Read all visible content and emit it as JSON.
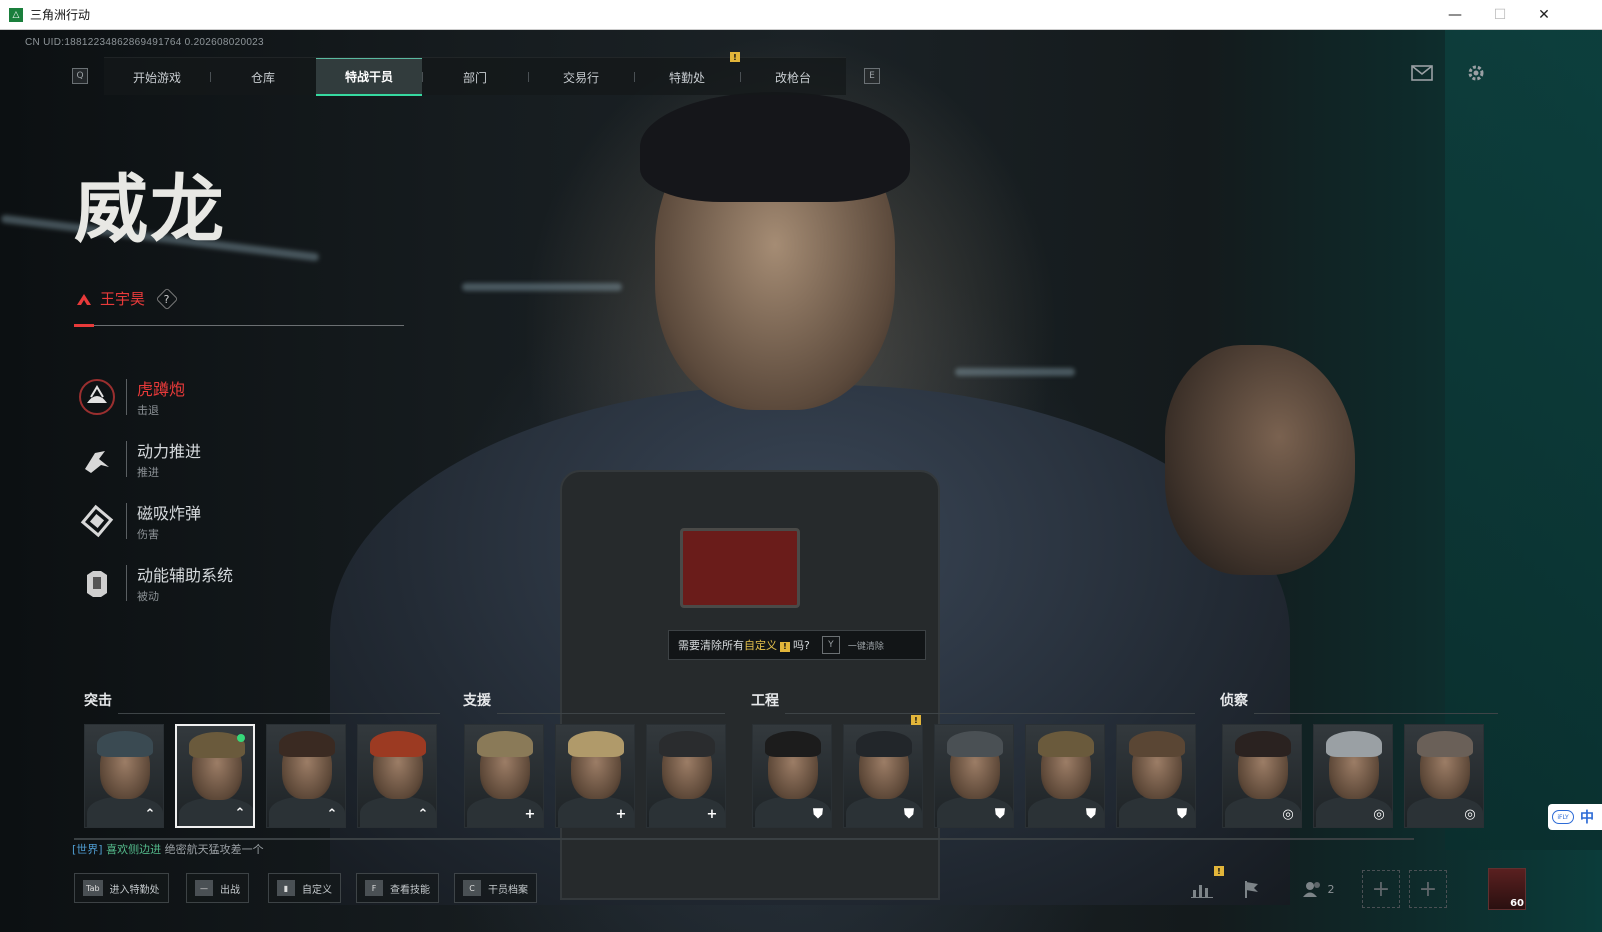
{
  "window": {
    "title": "三角洲行动",
    "min": "—",
    "max": "☐",
    "close": "✕"
  },
  "uid": "CN UID:18812234862869491764 0.202608020023",
  "nav": {
    "left_key": "Q",
    "right_key": "E",
    "tabs": [
      "开始游戏",
      "仓库",
      "特战干员",
      "部门",
      "交易行",
      "特勤处",
      "改枪台"
    ],
    "active_tab": "特战干员",
    "warn_mark": "!"
  },
  "agent": {
    "name": "威龙",
    "real_name": "王宇昊",
    "help": "?",
    "skills": [
      {
        "name": "虎蹲炮",
        "type": "击退",
        "icon": "tiger-cannon-icon",
        "active": true
      },
      {
        "name": "动力推进",
        "type": "推进",
        "icon": "power-thrust-icon",
        "active": false
      },
      {
        "name": "磁吸炸弹",
        "type": "伤害",
        "icon": "magnetic-bomb-icon",
        "active": false
      },
      {
        "name": "动能辅助系统",
        "type": "被动",
        "icon": "kinetic-assist-icon",
        "active": false
      }
    ]
  },
  "clear_tip": {
    "text_a": "需要清除所有",
    "text_hl": "自定义",
    "text_b": "吗?",
    "key": "Y",
    "action": "一键清除"
  },
  "categories": [
    {
      "label": "突击"
    },
    {
      "label": "支援"
    },
    {
      "label": "工程"
    },
    {
      "label": "侦察"
    }
  ],
  "roster": [
    {
      "category": "突击",
      "role": "assault-icon",
      "hair": "#3a4a52"
    },
    {
      "category": "突击",
      "role": "assault-icon",
      "hair": "#6a5a3c",
      "selected": true,
      "online": true
    },
    {
      "category": "突击",
      "role": "assault-icon",
      "hair": "#3a2a22"
    },
    {
      "category": "突击",
      "role": "assault-icon",
      "hair": "#9c3a22"
    },
    {
      "category": "支援",
      "role": "support-icon",
      "hair": "#8a7a58"
    },
    {
      "category": "支援",
      "role": "support-icon",
      "hair": "#b09a6a"
    },
    {
      "category": "支援",
      "role": "support-icon",
      "hair": "#2a2c2e"
    },
    {
      "category": "工程",
      "role": "engineer-icon",
      "hair": "#1c1c1c"
    },
    {
      "category": "工程",
      "role": "engineer-icon",
      "hair": "#22262a",
      "warn": true
    },
    {
      "category": "工程",
      "role": "engineer-icon",
      "hair": "#4a5054"
    },
    {
      "category": "工程",
      "role": "engineer-icon",
      "hair": "#6a5a3c"
    },
    {
      "category": "工程",
      "role": "engineer-icon",
      "hair": "#5a4634"
    },
    {
      "category": "侦察",
      "role": "recon-icon",
      "hair": "#2a2220"
    },
    {
      "category": "侦察",
      "role": "recon-icon",
      "hair": "#9aa0a4"
    },
    {
      "category": "侦察",
      "role": "recon-icon",
      "hair": "#6a6058"
    }
  ],
  "chat": {
    "channel": "[世界]",
    "name": "喜欢侧边进",
    "message": "绝密航天猛攻差一个"
  },
  "bottom": {
    "buttons": [
      {
        "key": "Tab",
        "label": "进入特勤处"
      },
      {
        "key": "—",
        "label": "出战"
      },
      {
        "key": "▮",
        "label": "自定义"
      },
      {
        "key": "F",
        "label": "查看技能"
      },
      {
        "key": "C",
        "label": "干员档案"
      }
    ],
    "team_count": "2",
    "player_level": "60",
    "plus": "+"
  },
  "ime": {
    "logo": "iFLY",
    "lang": "中"
  },
  "colors": {
    "accent_green": "#36d9a0",
    "accent_red": "#e83a3a",
    "warn_yellow": "#e2b53a",
    "teal": "#0b3c3a"
  }
}
